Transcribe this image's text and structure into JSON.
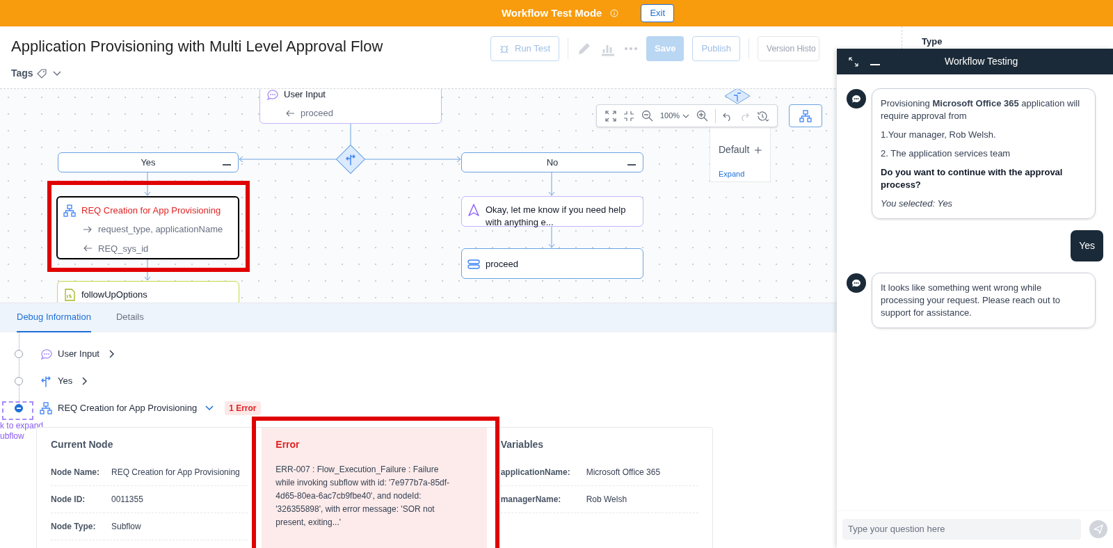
{
  "banner": {
    "title": "Workflow Test Mode",
    "exit_label": "Exit"
  },
  "header": {
    "title": "Application Provisioning with Multi Level Approval Flow",
    "tags_label": "Tags",
    "run_test": "Run Test",
    "save": "Save",
    "publish": "Publish",
    "version_history": "Version Histo"
  },
  "side_panel": {
    "heading": "Type"
  },
  "canvas": {
    "zoom": "100%",
    "nodes": [
      {
        "kind": "user_input",
        "title": "User Input",
        "outputs": [
          "proceed"
        ],
        "error": false
      },
      {
        "kind": "branch",
        "title": "Yes",
        "error": false
      },
      {
        "kind": "branch",
        "title": "No",
        "error": false
      },
      {
        "kind": "subflow",
        "title": "REQ Creation for App Provisioning",
        "inputs": [
          "request_type, applicationName"
        ],
        "outputs": [
          "REQ_sys_id"
        ],
        "error": true
      },
      {
        "kind": "script",
        "title": "followUpOptions",
        "error": false
      },
      {
        "kind": "message",
        "title": "Okay, let me know if you need help with anything e...",
        "error": false
      },
      {
        "kind": "variable",
        "title": "proceed",
        "error": false
      }
    ],
    "default_panel": {
      "label": "Default",
      "link": "Expand"
    }
  },
  "debug": {
    "tabs": [
      {
        "label": "Debug Information",
        "selected": true
      },
      {
        "label": "Details",
        "selected": false
      }
    ],
    "trail": [
      {
        "kind": "user_input",
        "label": "User Input",
        "expanded": false,
        "selected": false
      },
      {
        "kind": "branch",
        "label": "Yes",
        "expanded": false,
        "selected": false
      },
      {
        "kind": "subflow",
        "label": "REQ Creation for App Provisioning",
        "expanded": true,
        "selected": true,
        "badge": "1 Error"
      }
    ],
    "expand_hint": [
      "k to expand",
      "ubflow"
    ],
    "current_node": {
      "title": "Current Node",
      "rows": [
        {
          "label": "Node Name:",
          "value": "REQ Creation for App Provisioning"
        },
        {
          "label": "Node ID:",
          "value": "0011355"
        },
        {
          "label": "Node Type:",
          "value": "Subflow"
        }
      ]
    },
    "error": {
      "title": "Error",
      "message": "ERR-007 : Flow_Execution_Failure : Failure while invoking subflow with id: '7e977b7a-85df-4d65-80ea-6ac7cb9fbe40', and nodeId: '326355898', with error message: 'SOR not present, exiting...'"
    },
    "variables": {
      "title": "Variables",
      "rows": [
        {
          "label": "applicationName:",
          "value": "Microsoft Office 365"
        },
        {
          "label": "managerName:",
          "value": "Rob Welsh"
        }
      ]
    }
  },
  "chat": {
    "title": "Workflow Testing",
    "placeholder": "Type your question here",
    "messages": [
      {
        "kind": "bot",
        "paragraphs": [
          {
            "kind": "text",
            "text": "Provisioning **Microsoft Office 365** application will require approval from"
          },
          {
            "kind": "text",
            "text": "1.Your manager, Rob Welsh."
          },
          {
            "kind": "text",
            "text": "2. The application services team"
          },
          {
            "kind": "question",
            "text": "Do you want to continue with the approval process?"
          },
          {
            "kind": "selection",
            "text": "You selected: Yes"
          }
        ]
      },
      {
        "kind": "user",
        "text": "Yes"
      },
      {
        "kind": "bot",
        "paragraphs": [
          {
            "kind": "text",
            "text": "It looks like something went wrong while processing your request. Please reach out to support for assistance."
          }
        ]
      }
    ]
  }
}
